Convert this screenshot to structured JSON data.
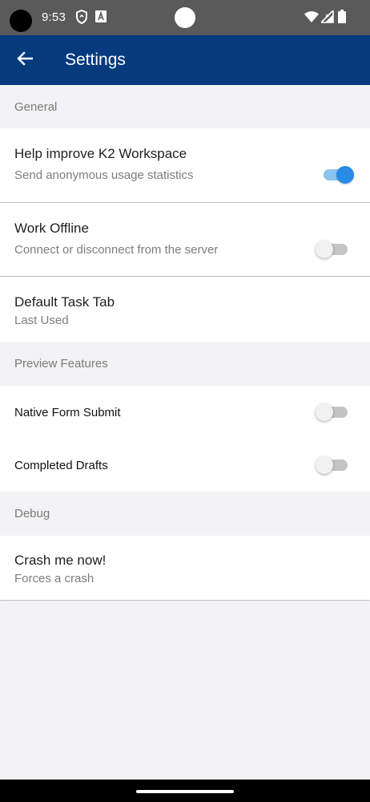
{
  "status_bar": {
    "time": "9:53",
    "icons": [
      "shield-icon",
      "a-box-icon",
      "wifi-icon",
      "signal-icon",
      "battery-icon"
    ]
  },
  "app_bar": {
    "title": "Settings",
    "back_icon": "arrow-back-icon",
    "background": "#053a7d"
  },
  "sections": {
    "general": {
      "header": "General",
      "help_improve": {
        "title": "Help improve K2 Workspace",
        "subtitle": "Send anonymous usage statistics",
        "enabled": true
      },
      "work_offline": {
        "title": "Work Offline",
        "subtitle": "Connect or disconnect from the server",
        "enabled": false
      },
      "default_task_tab": {
        "title": "Default Task Tab",
        "value": "Last Used"
      }
    },
    "preview": {
      "header": "Preview Features",
      "native_form_submit": {
        "title": "Native Form Submit",
        "enabled": false
      },
      "completed_drafts": {
        "title": "Completed Drafts",
        "enabled": false
      }
    },
    "debug": {
      "header": "Debug",
      "crash": {
        "title": "Crash me now!",
        "subtitle": "Forces a crash"
      }
    }
  },
  "colors": {
    "accent": "#2a8be6",
    "toggle_on_track": "#8cc3ef",
    "toggle_off_track": "#c4c4c4"
  }
}
